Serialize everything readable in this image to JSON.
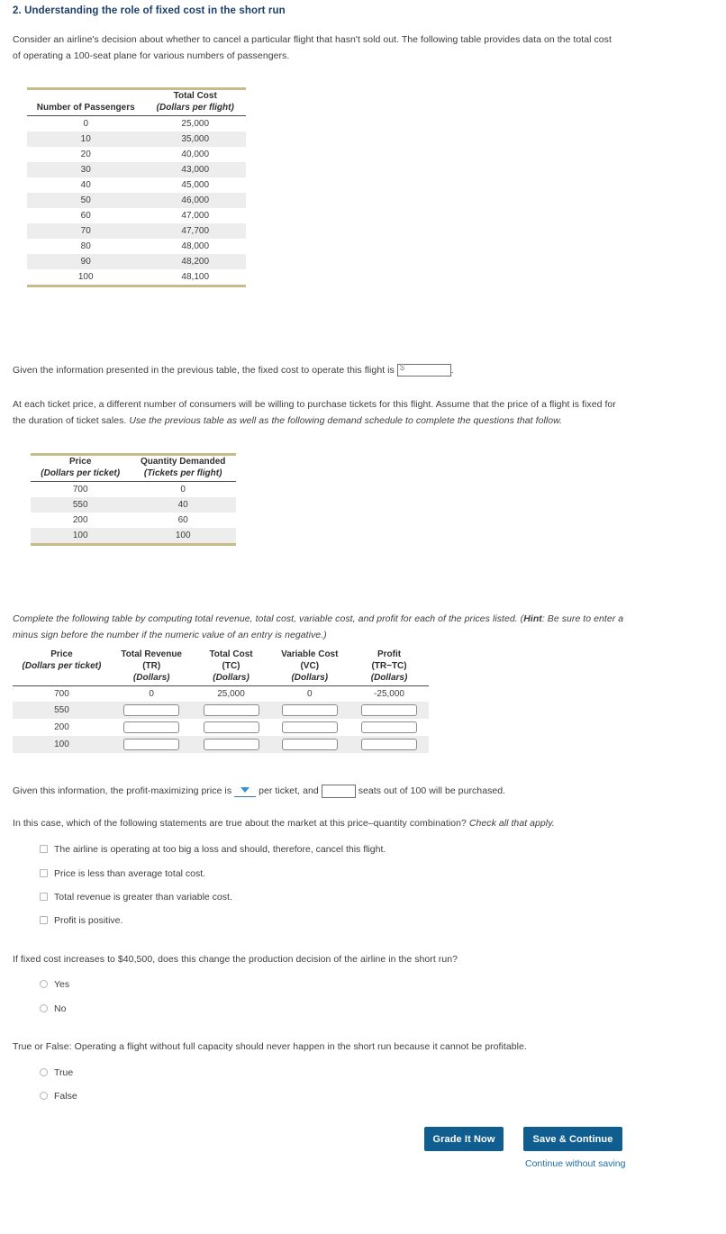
{
  "heading": "2. Understanding the role of fixed cost in the short run",
  "intro_paragraph": "Consider an airline's decision about whether to cancel a particular flight that hasn't sold out. The following table provides data on the total cost of operating a 100-seat plane for various numbers of passengers.",
  "cost_table": {
    "headers": {
      "col1_title": "Number of Passengers",
      "col2_title": "Total Cost",
      "col2_unit": "(Dollars per flight)"
    },
    "rows": [
      {
        "passengers": "0",
        "total_cost": "25,000"
      },
      {
        "passengers": "10",
        "total_cost": "35,000"
      },
      {
        "passengers": "20",
        "total_cost": "40,000"
      },
      {
        "passengers": "30",
        "total_cost": "43,000"
      },
      {
        "passengers": "40",
        "total_cost": "45,000"
      },
      {
        "passengers": "50",
        "total_cost": "46,000"
      },
      {
        "passengers": "60",
        "total_cost": "47,000"
      },
      {
        "passengers": "70",
        "total_cost": "47,700"
      },
      {
        "passengers": "80",
        "total_cost": "48,000"
      },
      {
        "passengers": "90",
        "total_cost": "48,200"
      },
      {
        "passengers": "100",
        "total_cost": "48,100"
      }
    ]
  },
  "fixed_cost_question": {
    "text_before": "Given the information presented in the previous table, the fixed cost to operate this flight is",
    "currency_prefix": "$",
    "input_value": "",
    "text_after": "."
  },
  "demand_intro": {
    "part1": "At each ticket price, a different number of consumers will be willing to purchase tickets for this flight. Assume that the price of a flight is fixed for the duration of ticket sales.",
    "part2_italic": "Use the previous table as well as the following demand schedule to complete the questions that follow."
  },
  "demand_table": {
    "headers": {
      "col1_title": "Price",
      "col1_unit": "(Dollars per ticket)",
      "col2_title": "Quantity Demanded",
      "col2_unit": "(Tickets per flight)"
    },
    "rows": [
      {
        "price": "700",
        "quantity": "0"
      },
      {
        "price": "550",
        "quantity": "40"
      },
      {
        "price": "200",
        "quantity": "60"
      },
      {
        "price": "100",
        "quantity": "100"
      }
    ]
  },
  "complete_table_instruction": {
    "part1_italic": "Complete the following table by computing total revenue, total cost, variable cost, and profit for each of the prices listed. (",
    "hint_bold": "Hint",
    "part2_italic": ": Be sure to enter a minus sign before the number if the numeric value of an entry is negative.)"
  },
  "profit_table": {
    "headers": [
      {
        "title": "Price",
        "sub": "",
        "unit": "(Dollars per ticket)"
      },
      {
        "title": "Total Revenue",
        "sub": "(TR)",
        "unit": "(Dollars)"
      },
      {
        "title": "Total Cost",
        "sub": "(TC)",
        "unit": "(Dollars)"
      },
      {
        "title": "Variable Cost",
        "sub": "(VC)",
        "unit": "(Dollars)"
      },
      {
        "title": "Profit",
        "sub": "(TR−TC)",
        "unit": "(Dollars)"
      }
    ],
    "rows": [
      {
        "price": "700",
        "tr": "0",
        "tc": "25,000",
        "vc": "0",
        "profit": "-25,000",
        "editable": false
      },
      {
        "price": "550",
        "tr": "",
        "tc": "",
        "vc": "",
        "profit": "",
        "editable": true
      },
      {
        "price": "200",
        "tr": "",
        "tc": "",
        "vc": "",
        "profit": "",
        "editable": true
      },
      {
        "price": "100",
        "tr": "",
        "tc": "",
        "vc": "",
        "profit": "",
        "editable": true
      }
    ]
  },
  "profit_max_question": {
    "text_before": "Given this information, the profit-maximizing price is",
    "dropdown_value": "",
    "text_middle": "per ticket, and",
    "seats_value": "",
    "text_after": "seats out of 100 will be purchased."
  },
  "checkbox_question": {
    "prompt_part1": "In this case, which of the following statements are true about the market at this price–quantity combination?",
    "prompt_italic": "Check all that apply.",
    "options": [
      "The airline is operating at too big a loss and should, therefore, cancel this flight.",
      "Price is less than average total cost.",
      "Total revenue is greater than variable cost.",
      "Profit is positive."
    ]
  },
  "fixed_cost_increase_question": {
    "prompt": "If fixed cost increases to $40,500, does this change the production decision of the airline in the short run?",
    "options": [
      "Yes",
      "No"
    ]
  },
  "true_false_question": {
    "prompt": "True or False: Operating a flight without full capacity should never happen in the short run because it cannot be profitable.",
    "options": [
      "True",
      "False"
    ]
  },
  "actions": {
    "grade_label": "Grade It Now",
    "save_label": "Save & Continue",
    "continue_link": "Continue without saving"
  },
  "colors": {
    "heading_blue": "#1c3f6e",
    "rule_tan": "#c8bb8a",
    "button_blue": "#0f5e8f",
    "link_blue": "#1e6fae",
    "row_alt": "#ededed"
  }
}
